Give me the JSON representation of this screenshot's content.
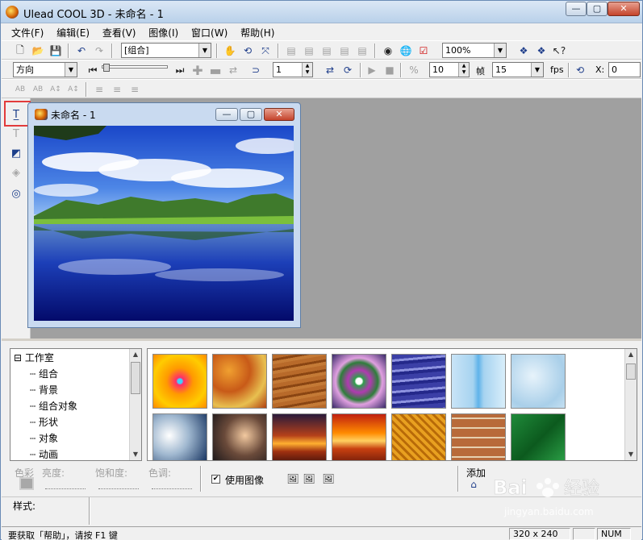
{
  "window": {
    "title": "Ulead COOL 3D - 未命名 - 1",
    "min_label": "—",
    "max_label": "▢",
    "close_label": "✕"
  },
  "menu": [
    "文件(F)",
    "编辑(E)",
    "查看(V)",
    "图像(I)",
    "窗口(W)",
    "帮助(H)"
  ],
  "toolbar1": {
    "object_combo": "[组合]",
    "zoom_combo": "100%"
  },
  "toolbar2": {
    "direction_combo": "方向",
    "frame_value": "1",
    "fps_step": "10",
    "frame_label": "帧",
    "fps_value": "15",
    "fps_label": "fps",
    "x_label": "X:",
    "x_value": "0"
  },
  "document": {
    "title": "未命名 - 1"
  },
  "tree": {
    "root": "工作室",
    "items": [
      "组合",
      "背景",
      "组合对象",
      "形状",
      "对象",
      "动画"
    ]
  },
  "gallery": {
    "row1": [
      "sunburst",
      "autumn-leaves",
      "wood-grain",
      "swirl",
      "blue-water",
      "ice-blue",
      "frost"
    ],
    "row2": [
      "clouds",
      "dark-sky",
      "sunset",
      "orange-sunset",
      "gold-weave",
      "brick",
      "green-fabric"
    ]
  },
  "controls": {
    "color": "色彩",
    "brightness": "亮度:",
    "saturation": "饱和度:",
    "hue": "色调:",
    "use_image": "使用图像",
    "add": "添加",
    "style": "样式:"
  },
  "status": {
    "help": "要获取「帮助」，请按 F1 键",
    "size": "320 x 240",
    "num": "NUM"
  },
  "watermark": {
    "brand": "Baidu 经验",
    "url": "jingyan.baidu.com"
  }
}
